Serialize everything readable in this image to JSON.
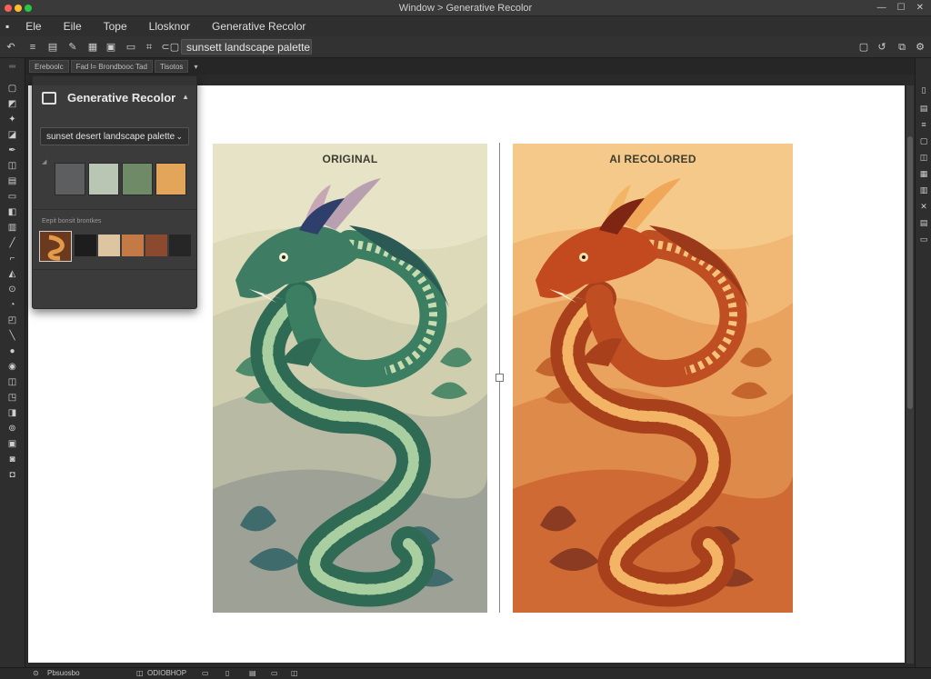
{
  "window": {
    "title": "Window > Generative Recolor",
    "colors": {
      "close": "#ff5f57",
      "min": "#febc2e",
      "max": "#28c840"
    }
  },
  "menu": [
    "Ele",
    "Eile",
    "Tope",
    "Llosknor",
    "Generative Recolor"
  ],
  "toolbar": {
    "prompt_chip": "sunsett landscape palette"
  },
  "tabs": [
    "Ereboolc",
    "Fad l= Brondbooc Tad",
    "Tisotos"
  ],
  "panel": {
    "title": "Generative Recolor",
    "prompt": "sunset desert landscape palette",
    "section_label": "Eepit bonsit brontkes",
    "palette_colors": [
      "#5d5e60",
      "#b9c6b4",
      "#6e8a66",
      "#e3a559"
    ],
    "mini_colors": [
      "#1d1d1d",
      "#dcc5a0",
      "#c47a44",
      "#8b4a30",
      "#262626"
    ]
  },
  "artboards": {
    "left_label": "ORIGINAL",
    "right_label": "AI RECOLORED"
  },
  "statusbar": {
    "left_text": "Pbsuosbo",
    "mid_text": "ODIOBHOP"
  }
}
